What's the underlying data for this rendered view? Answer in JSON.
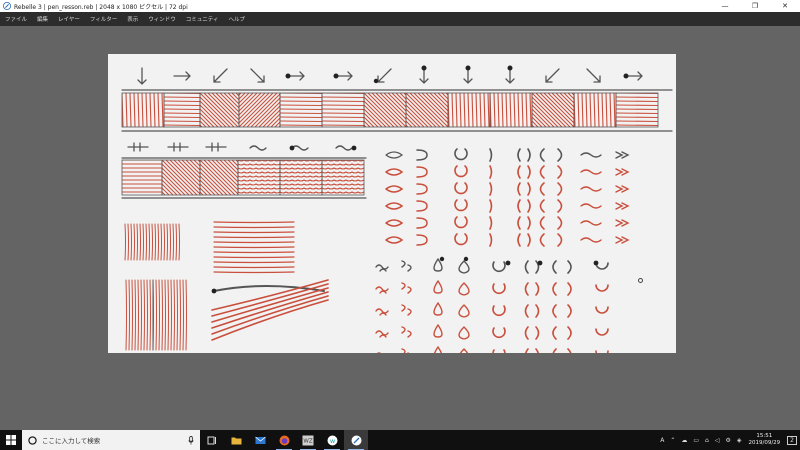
{
  "window": {
    "title": "Rebelle 3 | pen_resson.reb | 2048 x 1080 ピクセル | 72 dpi",
    "minimize": "—",
    "maximize": "❐",
    "close": "✕"
  },
  "menu": {
    "items": [
      "ファイル",
      "編集",
      "レイヤー",
      "フィルター",
      "表示",
      "ウィンドウ",
      "コミュニティ",
      "ヘルプ"
    ]
  },
  "canvas": {
    "stroke_color": "#c94f3c",
    "guide_color": "#555555"
  },
  "taskbar": {
    "search_placeholder": "ここに入力して検索",
    "apps": [
      "task-view-icon",
      "file-explorer-icon",
      "mail-icon",
      "firefox-icon",
      "wz-icon",
      "app-w-icon",
      "rebelle-icon"
    ],
    "tray_lang": "A",
    "time": "15:51",
    "date": "2019/09/29",
    "notifications": "2"
  }
}
